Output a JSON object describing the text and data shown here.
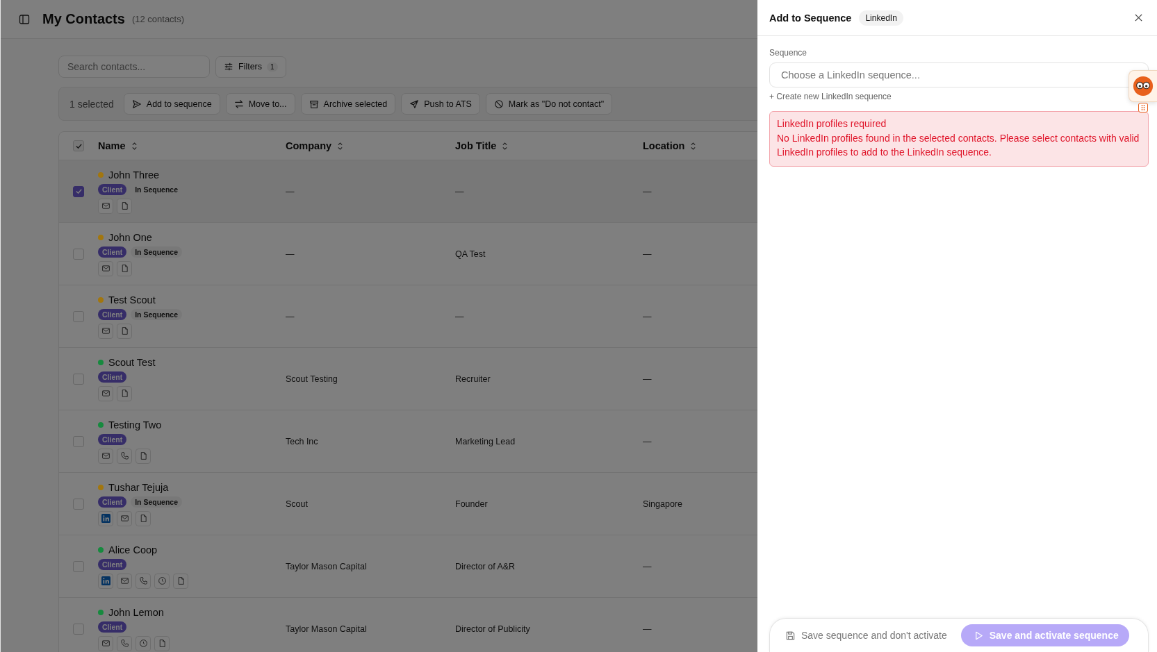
{
  "header": {
    "title": "My Contacts",
    "count": "(12 contacts)"
  },
  "search": {
    "placeholder": "Search contacts..."
  },
  "filters": {
    "label": "Filters",
    "count": "1"
  },
  "selection_bar": {
    "count": "1 selected",
    "actions": [
      {
        "kind": "send",
        "label": "Add to sequence"
      },
      {
        "kind": "move",
        "label": "Move to..."
      },
      {
        "kind": "archive",
        "label": "Archive selected"
      },
      {
        "kind": "push",
        "label": "Push to ATS"
      },
      {
        "kind": "block",
        "label": "Mark as \"Do not contact\""
      }
    ]
  },
  "table": {
    "select_all_checked": true,
    "columns": [
      "Name",
      "Company",
      "Job Title",
      "Location"
    ],
    "rows": [
      {
        "selected": true,
        "name": "John Three",
        "color": "#a2760e",
        "tags": [
          {
            "kind": "client",
            "label": "Client"
          },
          {
            "kind": "status",
            "label": "In Sequence"
          }
        ],
        "icons": [
          {
            "kind": "email"
          },
          {
            "kind": "doc"
          }
        ],
        "company": "—",
        "job_title": "—",
        "location": "—"
      },
      {
        "selected": false,
        "name": "John One",
        "color": "#a2760e",
        "tags": [
          {
            "kind": "client",
            "label": "Client"
          },
          {
            "kind": "status",
            "label": "In Sequence"
          }
        ],
        "icons": [
          {
            "kind": "email"
          },
          {
            "kind": "doc"
          }
        ],
        "company": "—",
        "job_title": "QA Test",
        "location": "—"
      },
      {
        "selected": false,
        "name": "Test Scout",
        "color": "#a2760e",
        "tags": [
          {
            "kind": "client",
            "label": "Client"
          },
          {
            "kind": "status",
            "label": "In Sequence"
          }
        ],
        "icons": [
          {
            "kind": "email"
          },
          {
            "kind": "doc"
          }
        ],
        "company": "—",
        "job_title": "—",
        "location": "—"
      },
      {
        "selected": false,
        "name": "Scout Test",
        "color": "#168a3e",
        "tags": [
          {
            "kind": "client",
            "label": "Client"
          }
        ],
        "icons": [
          {
            "kind": "email"
          },
          {
            "kind": "doc"
          }
        ],
        "company": "Scout Testing",
        "job_title": "Recruiter",
        "location": "—"
      },
      {
        "selected": false,
        "name": "Testing Two",
        "color": "#168a3e",
        "tags": [
          {
            "kind": "client",
            "label": "Client"
          }
        ],
        "icons": [
          {
            "kind": "email"
          },
          {
            "kind": "phone"
          },
          {
            "kind": "doc"
          }
        ],
        "company": "Tech Inc",
        "job_title": "Marketing Lead",
        "location": "—"
      },
      {
        "selected": false,
        "name": "Tushar Tejuja",
        "color": "#a2760e",
        "tags": [
          {
            "kind": "client",
            "label": "Client"
          },
          {
            "kind": "status",
            "label": "In Sequence"
          }
        ],
        "icons": [
          {
            "kind": "linkedin"
          },
          {
            "kind": "email"
          },
          {
            "kind": "doc"
          }
        ],
        "company": "Scout",
        "job_title": "Founder",
        "location": "Singapore"
      },
      {
        "selected": false,
        "name": "Alice Coop",
        "color": "#168a3e",
        "tags": [
          {
            "kind": "client",
            "label": "Client"
          }
        ],
        "icons": [
          {
            "kind": "linkedin"
          },
          {
            "kind": "email"
          },
          {
            "kind": "phone"
          },
          {
            "kind": "clock"
          },
          {
            "kind": "doc"
          }
        ],
        "company": "Taylor Mason Capital",
        "job_title": "Director of A&R",
        "location": "—"
      },
      {
        "selected": false,
        "name": "John Lemon",
        "color": "#168a3e",
        "tags": [
          {
            "kind": "client",
            "label": "Client"
          }
        ],
        "icons": [
          {
            "kind": "email"
          },
          {
            "kind": "phone"
          },
          {
            "kind": "clock"
          },
          {
            "kind": "doc"
          }
        ],
        "company": "Taylor Mason Capital",
        "job_title": "Director of Publicity",
        "location": "—"
      }
    ]
  },
  "panel": {
    "title": "Add to Sequence",
    "channel": "LinkedIn",
    "sequence_label": "Sequence",
    "sequence_placeholder": "Choose a LinkedIn sequence...",
    "create_link": "+ Create new LinkedIn sequence",
    "alert": {
      "title": "LinkedIn profiles required",
      "message": "No LinkedIn profiles found in the selected contacts. Please select contacts with valid LinkedIn profiles to add to the LinkedIn sequence."
    },
    "footer": {
      "save_label": "Save sequence and don't activate",
      "activate_label": "Save and activate sequence",
      "activate_disabled": true
    }
  }
}
